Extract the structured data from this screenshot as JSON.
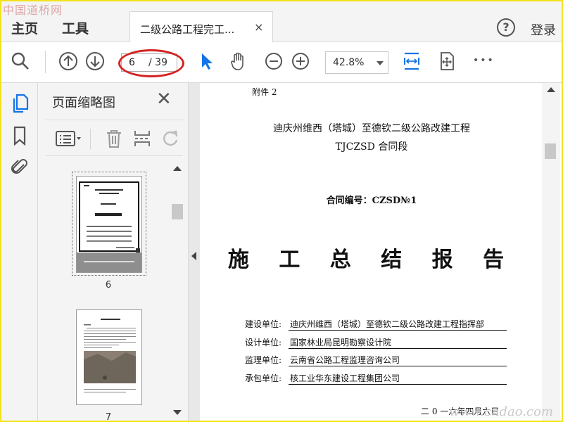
{
  "watermarks": {
    "top_left": "中国道桥网",
    "bottom_right": "www.cndao.com"
  },
  "menu": {
    "home": "主页",
    "tools": "工具"
  },
  "tab": {
    "title": "二级公路工程完工...",
    "close": "×"
  },
  "header_right": {
    "help": "?",
    "login": "登录"
  },
  "toolbar": {
    "page_current": "6",
    "page_total": "/ 39",
    "zoom": "42.8%",
    "more": "•••"
  },
  "thumbnails_panel": {
    "title": "页面缩略图",
    "close": "✕",
    "pages": [
      {
        "label": "6"
      },
      {
        "label": "7"
      }
    ]
  },
  "document": {
    "attachment": "附件 2",
    "project_title": "迪庆州维西（塔城）至德钦二级公路改建工程",
    "section": "TJCZSD 合同段",
    "contract_no": "合同编号：CZSD№1",
    "report_title": "施 工 总 结 报 告",
    "units": [
      {
        "label": "建设单位:",
        "value": "迪庆州维西（塔城）至德钦二级公路改建工程指挥部"
      },
      {
        "label": "设计单位:",
        "value": "国家林业局昆明勘察设计院"
      },
      {
        "label": "监理单位:",
        "value": "云南省公路工程监理咨询公司"
      },
      {
        "label": "承包单位:",
        "value": "核工业华东建设工程集团公司"
      }
    ],
    "date": "二 0 一六年四月六日"
  },
  "colors": {
    "accent": "#1473e6",
    "highlight": "#d42323",
    "frame": "#f3e21a"
  }
}
